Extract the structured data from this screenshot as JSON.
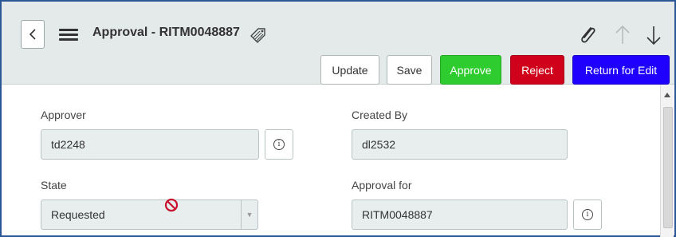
{
  "header": {
    "title": "Approval - RITM0048887",
    "buttons": {
      "update": "Update",
      "save": "Save",
      "approve": "Approve",
      "reject": "Reject",
      "return_for_edit": "Return for Edit"
    },
    "icons": [
      "chevron-left-icon",
      "hamburger-menu-icon",
      "tag-icon",
      "paperclip-icon",
      "arrow-up-icon",
      "arrow-down-icon"
    ]
  },
  "form": {
    "approver": {
      "label": "Approver",
      "value": "td2248"
    },
    "created_by": {
      "label": "Created By",
      "value": "dl2532"
    },
    "state": {
      "label": "State",
      "value": "Requested"
    },
    "approval_for": {
      "label": "Approval for",
      "value": "RITM0048887"
    }
  },
  "colors": {
    "header_bg": "#e4eaea",
    "approve": "#2ecc2e",
    "reject": "#d0021b",
    "return_for_edit": "#1f00ff",
    "frame_border": "#2b5797"
  }
}
